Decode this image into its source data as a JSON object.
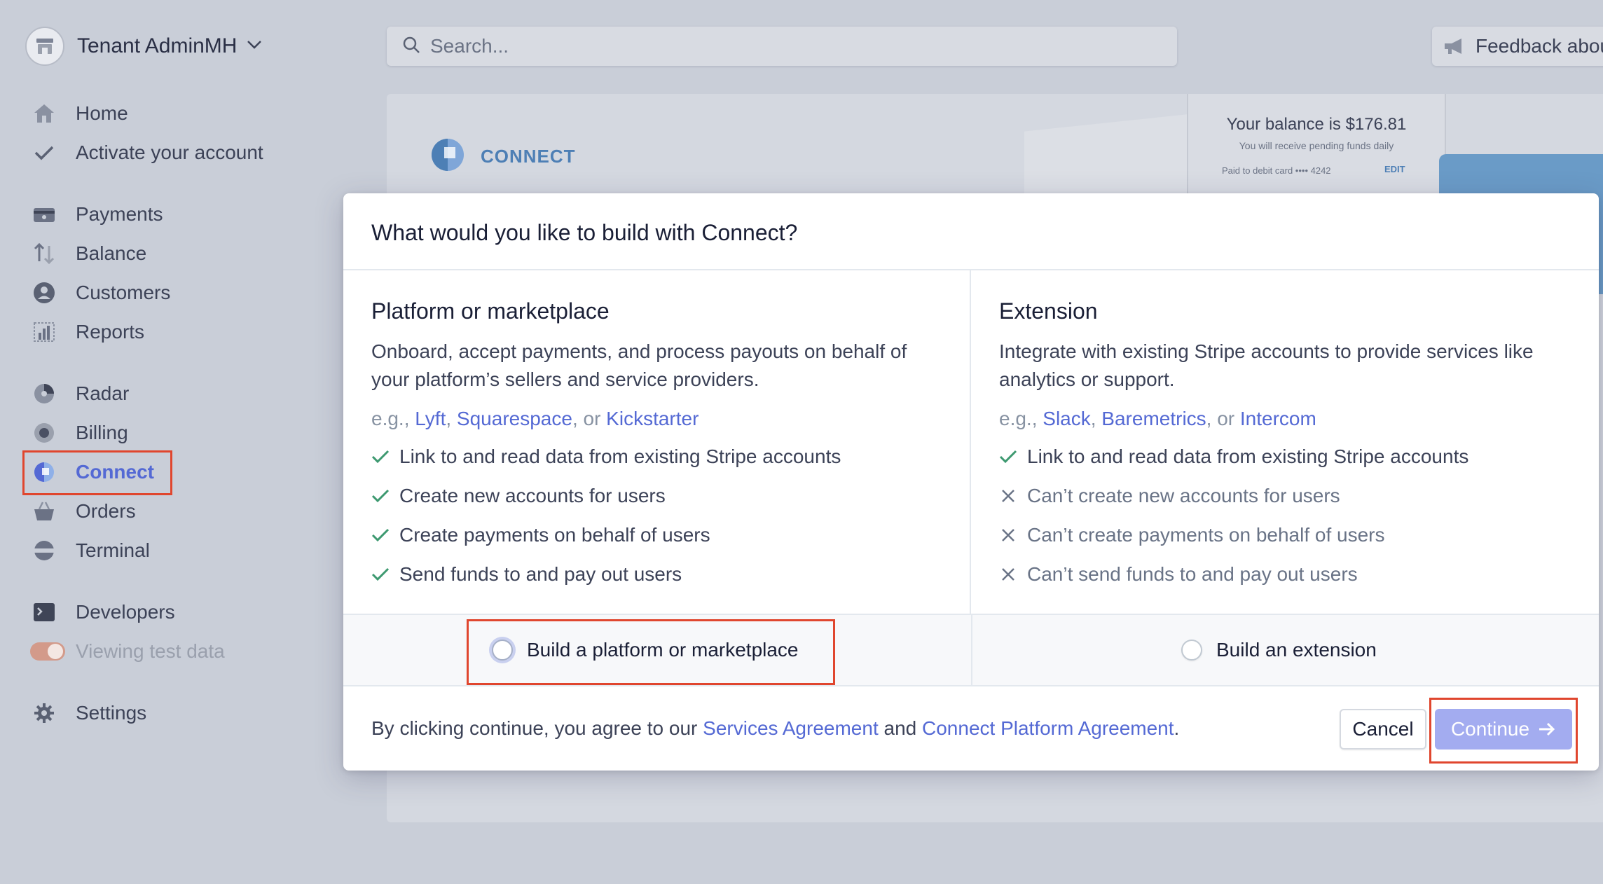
{
  "tenant": {
    "name": "Tenant AdminMH"
  },
  "search": {
    "placeholder": "Search..."
  },
  "feedback": {
    "label": "Feedback about"
  },
  "sidebar": {
    "group1": [
      {
        "label": "Home",
        "icon": "home-icon"
      },
      {
        "label": "Activate your account",
        "icon": "check-icon"
      }
    ],
    "group2": [
      {
        "label": "Payments",
        "icon": "payments-icon"
      },
      {
        "label": "Balance",
        "icon": "balance-icon"
      },
      {
        "label": "Customers",
        "icon": "customers-icon"
      },
      {
        "label": "Reports",
        "icon": "reports-icon"
      }
    ],
    "group3": [
      {
        "label": "Radar",
        "icon": "radar-icon"
      },
      {
        "label": "Billing",
        "icon": "billing-icon"
      },
      {
        "label": "Connect",
        "icon": "connect-icon",
        "active": true
      },
      {
        "label": "Orders",
        "icon": "orders-icon"
      },
      {
        "label": "Terminal",
        "icon": "terminal-icon"
      }
    ],
    "group4": [
      {
        "label": "Developers",
        "icon": "developers-icon"
      },
      {
        "label": "Viewing test data",
        "icon": "toggle-icon"
      }
    ],
    "group5": [
      {
        "label": "Settings",
        "icon": "gear-icon"
      }
    ]
  },
  "background": {
    "brand": "CONNECT",
    "balance_title": "Your balance is $176.81",
    "balance_sub": "You will receive pending funds daily",
    "balance_card": "Paid to debit card  •••• 4242",
    "balance_edit": "EDIT"
  },
  "modal": {
    "title": "What would you like to build with Connect?",
    "platform": {
      "heading": "Platform or marketplace",
      "description": "Onboard, accept payments, and process payouts on behalf of your platform’s sellers and service providers.",
      "eg_prefix": "e.g., ",
      "examples": [
        "Lyft",
        "Squarespace",
        "Kickstarter"
      ],
      "features": [
        "Link to and read data from existing Stripe accounts",
        "Create new accounts for users",
        "Create payments on behalf of users",
        "Send funds to and pay out users"
      ],
      "choice": "Build a platform or marketplace"
    },
    "extension": {
      "heading": "Extension",
      "description": "Integrate with existing Stripe accounts to provide services like analytics or support.",
      "eg_prefix": "e.g., ",
      "examples": [
        "Slack",
        "Baremetrics",
        "Intercom"
      ],
      "features": [
        "Link to and read data from existing Stripe accounts",
        "Can’t create new accounts for users",
        "Can’t create payments on behalf of users",
        "Can’t send funds to and pay out users"
      ],
      "choice": "Build an extension"
    },
    "footer": {
      "agree_prefix": "By clicking continue, you agree to our ",
      "services_link": "Services Agreement",
      "and": " and ",
      "platform_link": "Connect Platform Agreement",
      "period": ".",
      "cancel": "Cancel",
      "continue": "Continue"
    }
  },
  "colors": {
    "accent": "#5469d4",
    "highlight": "#e0462e",
    "check": "#3d9970",
    "continue_bg": "#a3acf0"
  }
}
